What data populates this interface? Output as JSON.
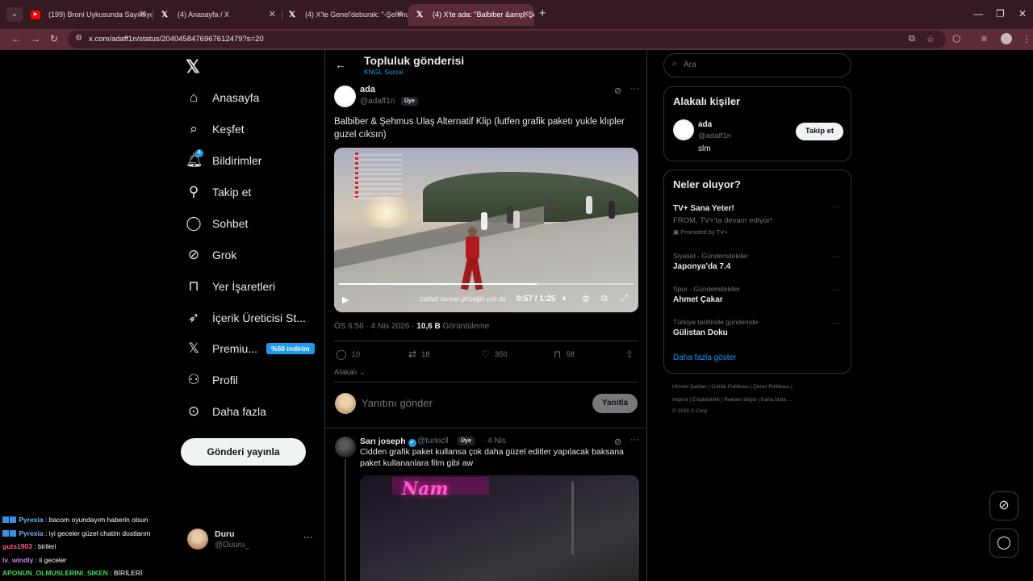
{
  "browser": {
    "tabs": [
      {
        "title": "(199) Broni Uykusunda Sayıklıyor"
      },
      {
        "title": "(4) Anasayfa / X"
      },
      {
        "title": "(4) X'te Genel'deburak: \"-Şehmus"
      },
      {
        "title": "(4) X'te ada: \"Balbiber &amp; Şehmus"
      }
    ],
    "url": "x.com/adaff1n/status/2040458476967612479?s=20"
  },
  "nav": {
    "home": "Anasayfa",
    "explore": "Keşfet",
    "notifications": "Bildirimler",
    "notif_count": "4",
    "follow": "Takip et",
    "chat": "Sohbet",
    "grok": "Grok",
    "bookmarks": "Yer İşaretleri",
    "creator": "İçerik Üreticisi St...",
    "premium": "Premiu...",
    "premium_badge": "%50 indirim",
    "profile": "Profil",
    "more": "Daha fazla",
    "post_button": "Gönderi yayınla",
    "account_name": "Duru",
    "account_handle": "@Duuru_"
  },
  "chat_overlay": [
    {
      "user": "Pyrexia",
      "message": "bacom oyundayım haberin olsun",
      "color": "#6ab8ff",
      "badge": true
    },
    {
      "user": "Pyrexia",
      "message": "iyi geceler güzel chatim dostlarım",
      "color": "#6ab8ff",
      "badge": true
    },
    {
      "user": "guts1903",
      "message": "birileri",
      "color": "#ff5a8a",
      "badge": false
    },
    {
      "user": "lv_windly",
      "message": "ii geceler",
      "color": "#c77dff",
      "badge": false
    },
    {
      "user": "APONUN_OLMUSLERINI_SIKEN",
      "message": "BİRİLERİ",
      "color": "#3ddc5a",
      "badge": false
    }
  ],
  "post": {
    "header_title": "Topluluk gönderisi",
    "header_sub": "KNGL Social",
    "author_name": "ada",
    "author_handle": "@adaff1n",
    "member_label": "Üye",
    "text": "Balbiber & Şehmus Ulaş Alternatif Klip (lutfen grafik paketı yukle klıpler guzel cıksın)",
    "video_time": "0:57 / 1:25",
    "video_progress": 0.67,
    "video_caption": "zıpladı tavşan git'çeğin çok da",
    "timestamp": "ÖS 6:56 · 4 Nis 2026 ·",
    "views": "10,6 B",
    "views_label": "Görüntüleme",
    "replies": "10",
    "reposts": "18",
    "likes": "350",
    "bookmarks": "58",
    "relevant_label": "Alakalı",
    "reply_placeholder": "Yanıtını gönder",
    "reply_button": "Yanıtla"
  },
  "reply": {
    "name": "Sarı joseph",
    "handle": "@turkicll",
    "member_label": "Üye",
    "date": "· 4 Nis",
    "text": "Cidden grafik paket kullansa çok daha güzel editler yapılacak baksana paket kullananlara film gibi aw",
    "image_sign": "Nam"
  },
  "sidebar": {
    "search_placeholder": "Ara",
    "related_title": "Alakalı kişiler",
    "person_name": "ada",
    "person_handle": "@adaff1n",
    "person_bio": "slm",
    "follow_button": "Takip et",
    "trends_title": "Neler oluyor?",
    "trends": [
      {
        "category": "",
        "name": "TV+ Sana Yeter!",
        "sub": "FROM, TV+'ta devam ediyor!",
        "promo": "Promoted by TV+"
      },
      {
        "category": "Siyaset · Gündemdekiler",
        "name": "Japonya'da 7.4"
      },
      {
        "category": "Spor · Gündemdekiler",
        "name": "Ahmet Çakar"
      },
      {
        "category": "Türkiye tarihinde gündemde",
        "name": "Gülistan Doku"
      }
    ],
    "show_more": "Daha fazla göster",
    "footer_line1": "Hizmet Şartları  |  Gizlilik Politikası  |  Çerez Politikası  |",
    "footer_line2": "Imprint  |  Erişilebilirlik  |  Reklam bilgisi  |  Daha fazla ...",
    "footer_line3": "© 2026 X Corp."
  }
}
